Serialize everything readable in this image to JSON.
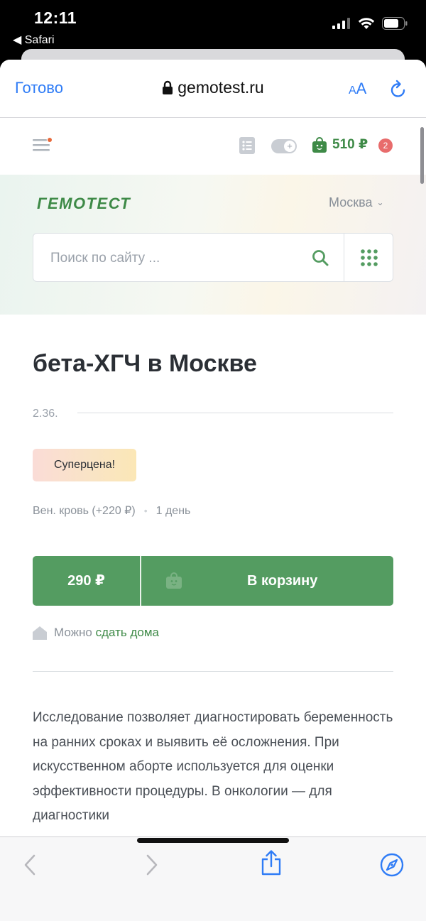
{
  "status_bar": {
    "time": "12:11",
    "back_app": "◀ Safari"
  },
  "browser": {
    "done_label": "Готово",
    "url": "gemotest.ru",
    "text_size_small": "A",
    "text_size_large": "A"
  },
  "site_header": {
    "cart_amount": "510 ₽",
    "cart_count": "2"
  },
  "hero": {
    "logo": "ГЕМОТЕСТ",
    "city": "Москва",
    "search_placeholder": "Поиск по сайту ..."
  },
  "product": {
    "title": "бета-ХГЧ в Москве",
    "code": "2.36.",
    "badge": "Суперцена!",
    "biomaterial": "Вен. кровь (+220 ₽)",
    "duration": "1 день",
    "price": "290 ₽",
    "cart_button": "В корзину",
    "home_text": "Можно",
    "home_link": "сдать дома",
    "description": "Исследование позволяет диагностировать беременность на ранних сроках и выявить её осложнения. При искусственном аборте используется для оценки эффективности процедуры. В онкологии — для диагностики"
  },
  "colors": {
    "brand_green": "#3e8a47",
    "button_green": "#549c61",
    "ios_blue": "#2f7cf6",
    "badge_red": "#e86c6c"
  },
  "icons": {
    "menu": "hamburger-icon",
    "list": "list-icon",
    "toggle": "toggle-icon",
    "cart": "shopping-bag-icon",
    "search": "search-icon",
    "grid": "grid-icon",
    "home": "house-icon",
    "back": "chevron-left-icon",
    "forward": "chevron-right-icon",
    "share": "share-icon",
    "compass": "compass-icon"
  }
}
